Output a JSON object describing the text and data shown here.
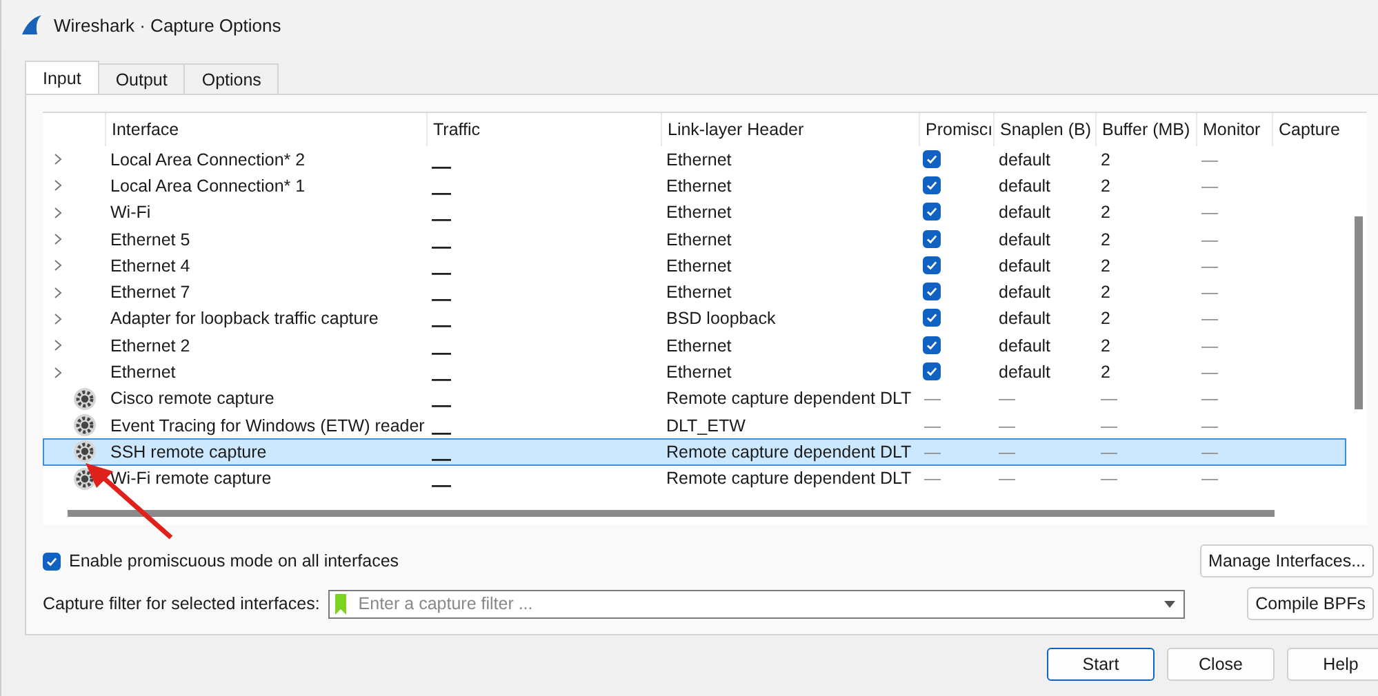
{
  "window": {
    "title": "Wireshark · Capture Options"
  },
  "tabs": [
    {
      "label": "Input",
      "selected": true
    },
    {
      "label": "Output",
      "selected": false
    },
    {
      "label": "Options",
      "selected": false
    }
  ],
  "table": {
    "columns": [
      "Interface",
      "Traffic",
      "Link-layer Header",
      "Promiscı",
      "Snaplen (B)",
      "Buffer (MB)",
      "Monitor",
      "Capture"
    ],
    "rows": [
      {
        "kind": "local",
        "name": "Local Area Connection* 2",
        "link": "Ethernet",
        "promisc": true,
        "snaplen": "default",
        "buffer": "2",
        "monitor": "—",
        "selected": false
      },
      {
        "kind": "local",
        "name": "Local Area Connection* 1",
        "link": "Ethernet",
        "promisc": true,
        "snaplen": "default",
        "buffer": "2",
        "monitor": "—",
        "selected": false
      },
      {
        "kind": "local",
        "name": "Wi-Fi",
        "link": "Ethernet",
        "promisc": true,
        "snaplen": "default",
        "buffer": "2",
        "monitor": "—",
        "selected": false
      },
      {
        "kind": "local",
        "name": "Ethernet 5",
        "link": "Ethernet",
        "promisc": true,
        "snaplen": "default",
        "buffer": "2",
        "monitor": "—",
        "selected": false
      },
      {
        "kind": "local",
        "name": "Ethernet 4",
        "link": "Ethernet",
        "promisc": true,
        "snaplen": "default",
        "buffer": "2",
        "monitor": "—",
        "selected": false
      },
      {
        "kind": "local",
        "name": "Ethernet 7",
        "link": "Ethernet",
        "promisc": true,
        "snaplen": "default",
        "buffer": "2",
        "monitor": "—",
        "selected": false
      },
      {
        "kind": "local",
        "name": "Adapter for loopback traffic capture",
        "link": "BSD loopback",
        "promisc": true,
        "snaplen": "default",
        "buffer": "2",
        "monitor": "—",
        "selected": false
      },
      {
        "kind": "local",
        "name": "Ethernet 2",
        "link": "Ethernet",
        "promisc": true,
        "snaplen": "default",
        "buffer": "2",
        "monitor": "—",
        "selected": false
      },
      {
        "kind": "local",
        "name": "Ethernet",
        "link": "Ethernet",
        "promisc": true,
        "snaplen": "default",
        "buffer": "2",
        "monitor": "—",
        "selected": false
      },
      {
        "kind": "extcap",
        "name": "Cisco remote capture",
        "link": "Remote capture dependent DLT",
        "promisc_text": "—",
        "snaplen": "—",
        "buffer": "—",
        "monitor": "—",
        "selected": false
      },
      {
        "kind": "extcap",
        "name": "Event Tracing for Windows (ETW) reader",
        "link": "DLT_ETW",
        "promisc_text": "—",
        "snaplen": "—",
        "buffer": "—",
        "monitor": "—",
        "selected": false
      },
      {
        "kind": "extcap",
        "name": "SSH remote capture",
        "link": "Remote capture dependent DLT",
        "promisc_text": "—",
        "snaplen": "—",
        "buffer": "—",
        "monitor": "—",
        "selected": true
      },
      {
        "kind": "extcap",
        "name": "Wi-Fi remote capture",
        "link": "Remote capture dependent DLT",
        "promisc_text": "—",
        "snaplen": "—",
        "buffer": "—",
        "monitor": "—",
        "selected": false
      }
    ]
  },
  "promiscuous_all": {
    "label": "Enable promiscuous mode on all interfaces",
    "checked": true
  },
  "manage_button": "Manage Interfaces...",
  "capture_filter": {
    "label": "Capture filter for selected interfaces:",
    "placeholder": "Enter a capture filter ..."
  },
  "compile_button": "Compile BPFs",
  "buttons": [
    {
      "label": "Start",
      "default": true
    },
    {
      "label": "Close",
      "default": false
    },
    {
      "label": "Help",
      "default": false
    }
  ]
}
